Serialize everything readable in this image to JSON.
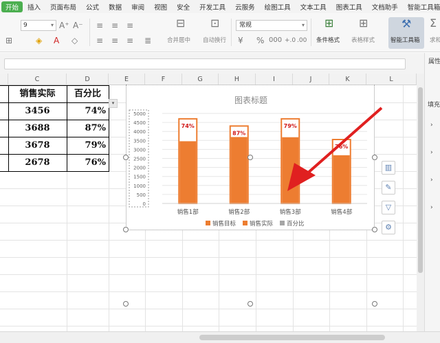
{
  "menu": {
    "items": [
      "开始",
      "插入",
      "页面布局",
      "公式",
      "数据",
      "审阅",
      "视图",
      "安全",
      "开发工具",
      "云服务",
      "绘图工具",
      "文本工具",
      "图表工具",
      "文档助手",
      "智能工具箱"
    ]
  },
  "ribbon": {
    "font_size": "9",
    "number_format": "常规",
    "merge_label": "合并居中",
    "wrap_label": "自动换行",
    "cond_format_label": "条件格式",
    "table_style_label": "表格样式",
    "sum_label": "求和",
    "smart_tool_label": "智能工具箱"
  },
  "grid": {
    "columns": [
      "C",
      "D",
      "E",
      "F",
      "G",
      "H",
      "I",
      "J",
      "K",
      "L"
    ],
    "header_row": [
      "销售实际",
      "百分比"
    ],
    "rows": [
      [
        "3456",
        "74%"
      ],
      [
        "3688",
        "87%"
      ],
      [
        "3678",
        "79%"
      ],
      [
        "2678",
        "76%"
      ]
    ]
  },
  "right_panel": {
    "title": "属性",
    "fill_label": "填充"
  },
  "chart_data": {
    "type": "bar",
    "title": "图表标题",
    "categories": [
      "销售1部",
      "销售2部",
      "销售3部",
      "销售4部"
    ],
    "series": [
      {
        "name": "销售目标",
        "values": [
          4700,
          4300,
          4700,
          3550
        ],
        "color": "#ed7d31"
      },
      {
        "name": "销售实际",
        "values": [
          3456,
          3688,
          3678,
          2678
        ],
        "color": "#ed7d31"
      },
      {
        "name": "百分比",
        "values": [
          0.74,
          0.87,
          0.79,
          0.76
        ],
        "color": "#a5a5a5"
      }
    ],
    "data_labels": [
      "74%",
      "87%",
      "79%",
      "76%"
    ],
    "ylim": [
      0,
      5000
    ],
    "yticks": [
      "0",
      "500",
      "1000",
      "1500",
      "2000",
      "2500",
      "3000",
      "3500",
      "4000",
      "4500",
      "5000"
    ],
    "legend": "bottom",
    "grid": true
  },
  "annotation": {
    "arrow_color": "#e02020"
  }
}
